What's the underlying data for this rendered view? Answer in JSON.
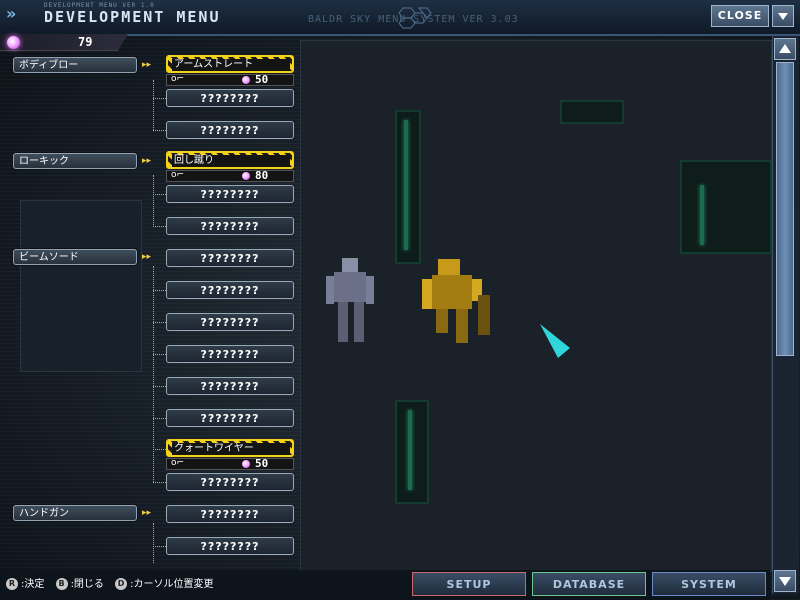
{
  "header": {
    "subtitle": "DEVELOPMENT MENU VER 1.0",
    "title": "DEVELOPMENT MENU",
    "system_text": "BALDR SKY MENU SYSTEM VER 3.03",
    "close_label": "CLOSE"
  },
  "points": {
    "value": "79"
  },
  "tree": {
    "cat1": "ボディブロー",
    "cat1_learn_label": "アームストレート",
    "cat1_cost": "50",
    "cat1_node2": "????????",
    "cat1_node3": "????????",
    "cat2": "ローキック",
    "cat2_learn_label": "回し蹴り",
    "cat2_cost": "80",
    "cat2_node2": "????????",
    "cat2_node3": "????????",
    "cat3": "ビームソード",
    "cat3_node1": "????????",
    "cat3_node2": "????????",
    "cat3_node3": "????????",
    "cat3_node4": "????????",
    "cat3_node5": "????????",
    "cat3_node6": "????????",
    "cat3_learn_label": "クォートワイヤー",
    "cat3_cost": "50",
    "cat3_node8": "????????",
    "cat4": "ハンドガン",
    "cat4_node1": "????????",
    "cat4_node2": "????????"
  },
  "footer": {
    "ctrl_r_icon": "R",
    "ctrl_r_label": ":決定",
    "ctrl_b_icon": "B",
    "ctrl_b_label": ":閉じる",
    "ctrl_d_icon": "D",
    "ctrl_d_label": ":カーソル位置変更",
    "setup_label": "SETUP",
    "database_label": "DATABASE",
    "system_label": "SYSTEM"
  },
  "colors": {
    "accent_yellow": "#f4d21a",
    "point_orb": "#e87bff",
    "header_blue": "#1e2f44"
  }
}
